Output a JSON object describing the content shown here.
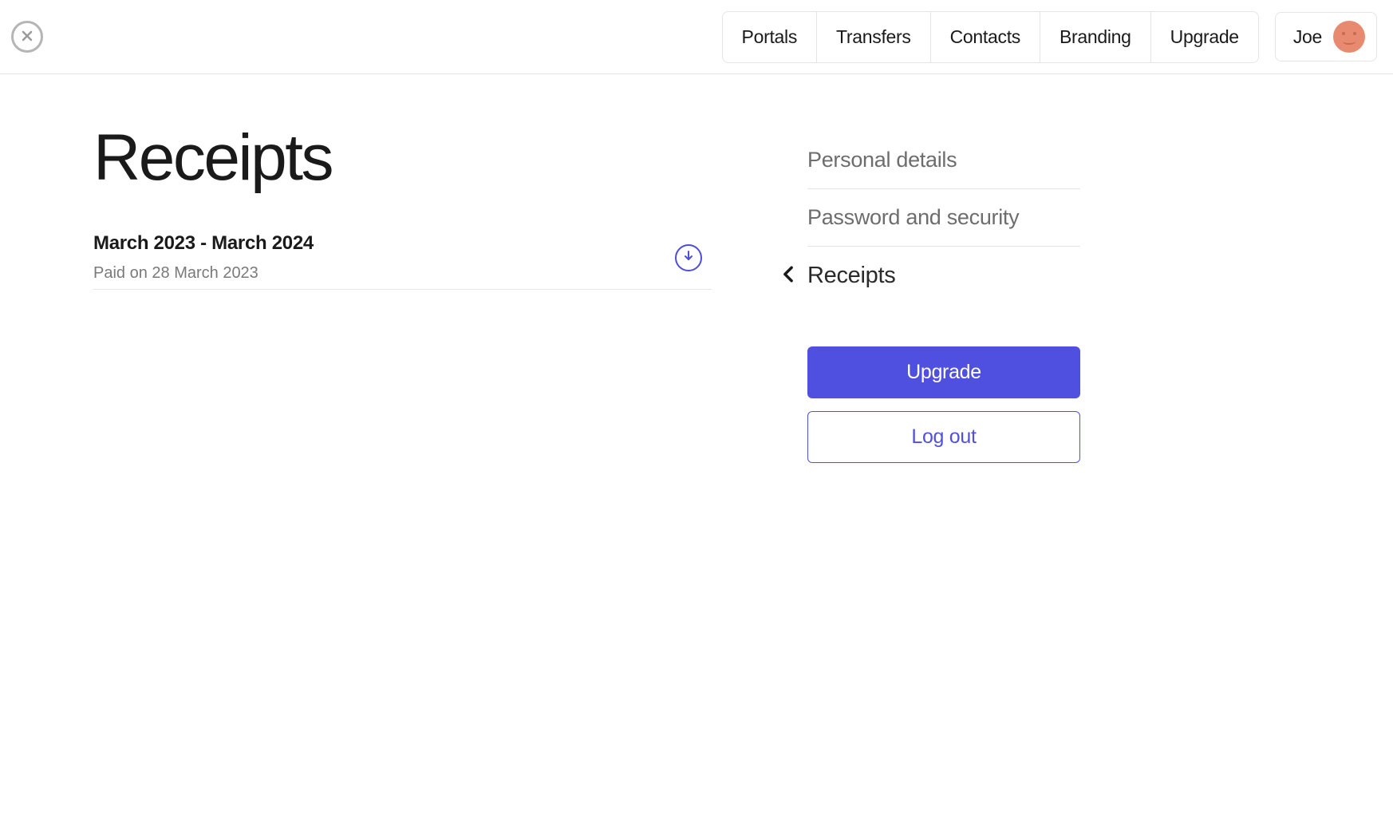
{
  "header": {
    "nav": [
      {
        "label": "Portals"
      },
      {
        "label": "Transfers"
      },
      {
        "label": "Contacts"
      },
      {
        "label": "Branding"
      },
      {
        "label": "Upgrade"
      }
    ],
    "user_name": "Joe"
  },
  "page": {
    "title": "Receipts"
  },
  "receipts": [
    {
      "period": "March 2023 - March 2024",
      "paid_text": "Paid on 28 March 2023"
    }
  ],
  "sidebar": {
    "items": [
      {
        "label": "Personal details",
        "active": false
      },
      {
        "label": "Password and security",
        "active": false
      },
      {
        "label": "Receipts",
        "active": true
      }
    ],
    "upgrade_label": "Upgrade",
    "logout_label": "Log out"
  },
  "colors": {
    "accent": "#5050e0",
    "avatar": "#e88a6f",
    "text_muted": "#7a7a7a"
  }
}
